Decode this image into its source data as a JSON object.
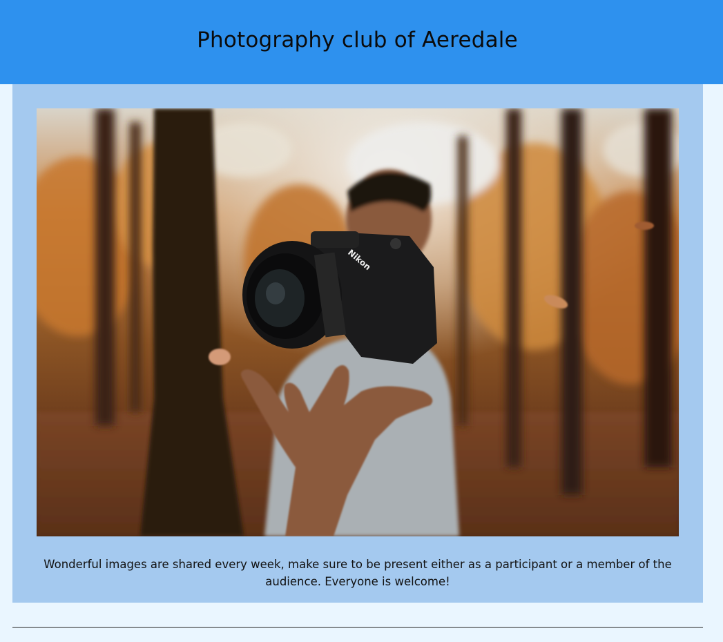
{
  "header": {
    "title": "Photography club of Aeredale"
  },
  "hero_image": {
    "alt": "Person tossing a camera in an autumn forest"
  },
  "caption": {
    "text": "Wonderful images are shared every week, make sure to be present either as a participant or a member of the audience. Everyone is welcome!"
  },
  "colors": {
    "header_bg": "#2e91ee",
    "panel_bg": "#a4c9ef",
    "page_bg": "#eaf6ff"
  }
}
